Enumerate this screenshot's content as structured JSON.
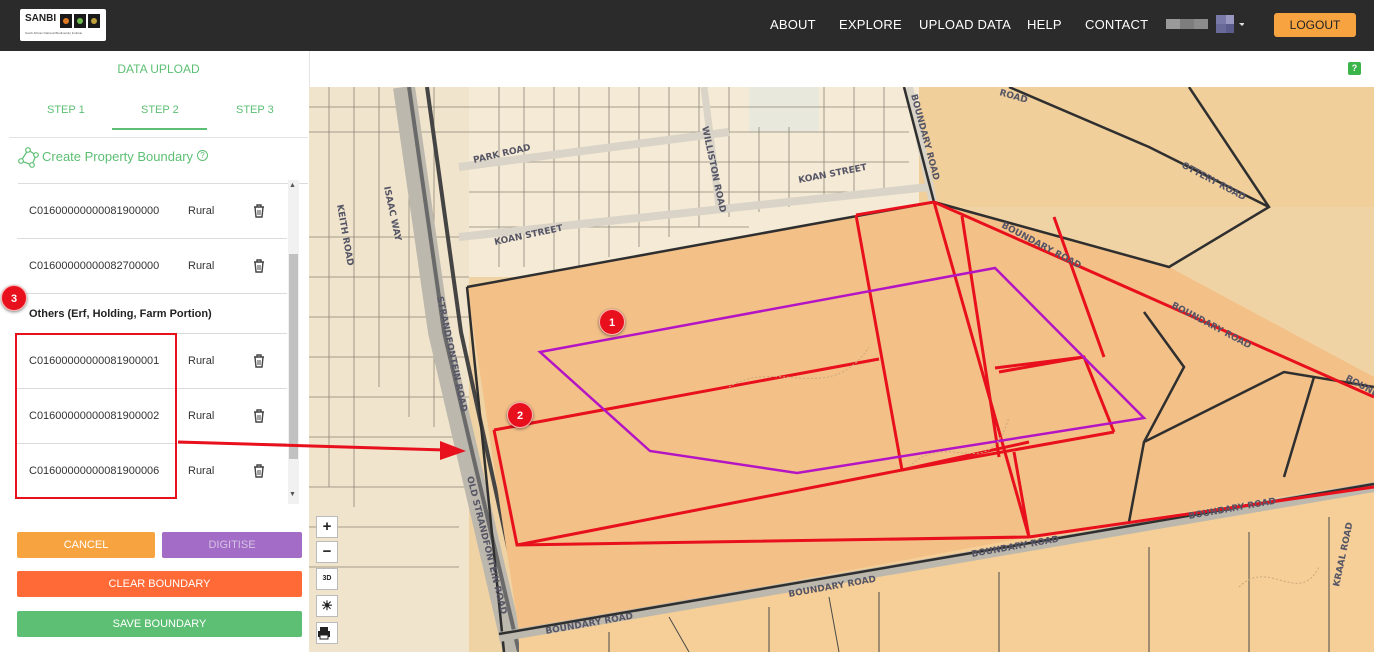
{
  "header": {
    "logo_text": "SANBI",
    "logo_subtext": "South African National Biodiversity Institute",
    "nav": [
      "ABOUT",
      "EXPLORE",
      "UPLOAD DATA",
      "HELP",
      "CONTACT"
    ],
    "logout_label": "LOGOUT"
  },
  "sidebar": {
    "title": "DATA UPLOAD",
    "tabs": [
      "STEP 1",
      "STEP 2",
      "STEP 3"
    ],
    "active_tab": "STEP 2",
    "create_label": "Create Property Boundary",
    "help_mark": "?",
    "rows_top": [
      {
        "code": "C01600000000081900000",
        "type": "Rural"
      },
      {
        "code": "C01600000000082700000",
        "type": "Rural"
      }
    ],
    "group_heading": "Others (Erf, Holding, Farm Portion)",
    "rows_others": [
      {
        "code": "C01600000000081900001",
        "type": "Rural"
      },
      {
        "code": "C01600000000081900002",
        "type": "Rural"
      },
      {
        "code": "C01600000000081900006",
        "type": "Rural"
      }
    ],
    "buttons": {
      "cancel": "CANCEL",
      "digitise": "DIGITISE",
      "clear": "CLEAR BOUNDARY",
      "save": "SAVE BOUNDARY"
    }
  },
  "map": {
    "help_badge": "?",
    "controls": {
      "zoom_in": "+",
      "zoom_out": "−",
      "three_d": "3D"
    },
    "road_labels": {
      "park": "PARK ROAD",
      "williston": "WILLISTON ROAD",
      "koan1": "KOAN STREET",
      "koan2": "KOAN STREET",
      "boundary_vertical": "BOUNDARY ROAD",
      "ottery": "OTTERY ROAD",
      "isaac": "ISAAC WAY",
      "keith": "KEITH ROAD",
      "boundary_diag1": "BOUNDARY ROAD",
      "boundary_diag2": "BOUNDARY ROAD",
      "boundary_cut": "BOUNDA",
      "strandfontein": "STRANDFONTEIN ROAD",
      "old_strandfontein": "OLD STRANDFONTEIN ROAD",
      "boundary_bottom1": "BOUNDARY ROAD",
      "boundary_bottom2": "BOUNDARY ROAD",
      "boundary_bottom3": "BOUNDARY ROAD",
      "boundary_bottom4": "BOUNDARY ROAD",
      "kraal": "KRAAL ROAD",
      "top_cut": "ROAD"
    }
  },
  "annotations": {
    "marker1": "1",
    "marker2": "2",
    "marker3": "3"
  },
  "colors": {
    "accent_green": "#5cbf73",
    "orange": "#f7a440",
    "purple": "#a26cc7",
    "red_orange": "#ff6a36",
    "marker_red": "#e8101c",
    "polygon_purple": "#b414c4"
  }
}
